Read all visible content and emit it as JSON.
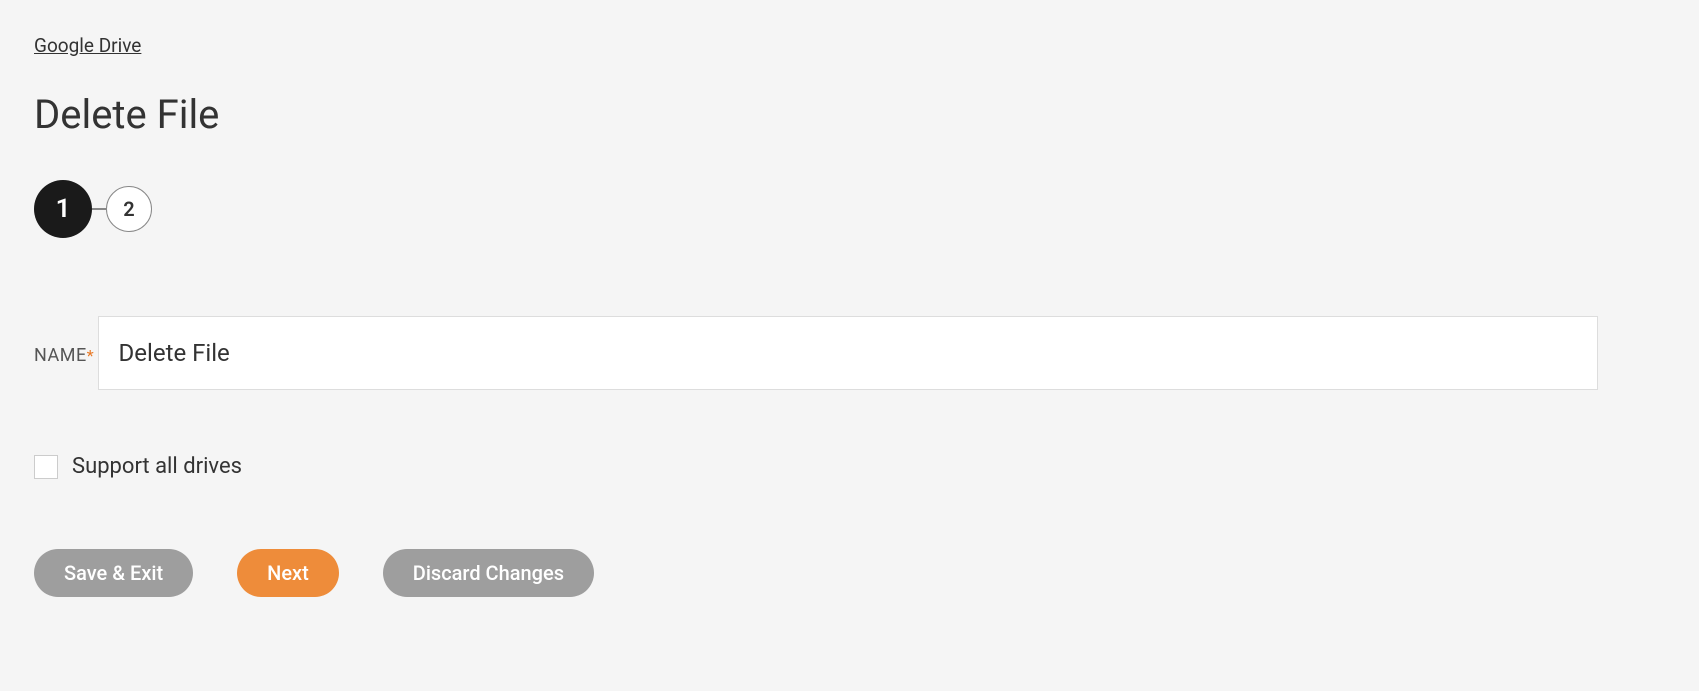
{
  "breadcrumb": {
    "label": "Google Drive"
  },
  "page": {
    "title": "Delete File"
  },
  "stepper": {
    "steps": [
      {
        "number": "1",
        "active": true
      },
      {
        "number": "2",
        "active": false
      }
    ]
  },
  "form": {
    "name_field": {
      "label": "NAME",
      "required_marker": "*",
      "value": "Delete File"
    },
    "support_all_drives": {
      "label": "Support all drives",
      "checked": false
    }
  },
  "buttons": {
    "save_exit": "Save & Exit",
    "next": "Next",
    "discard": "Discard Changes"
  }
}
